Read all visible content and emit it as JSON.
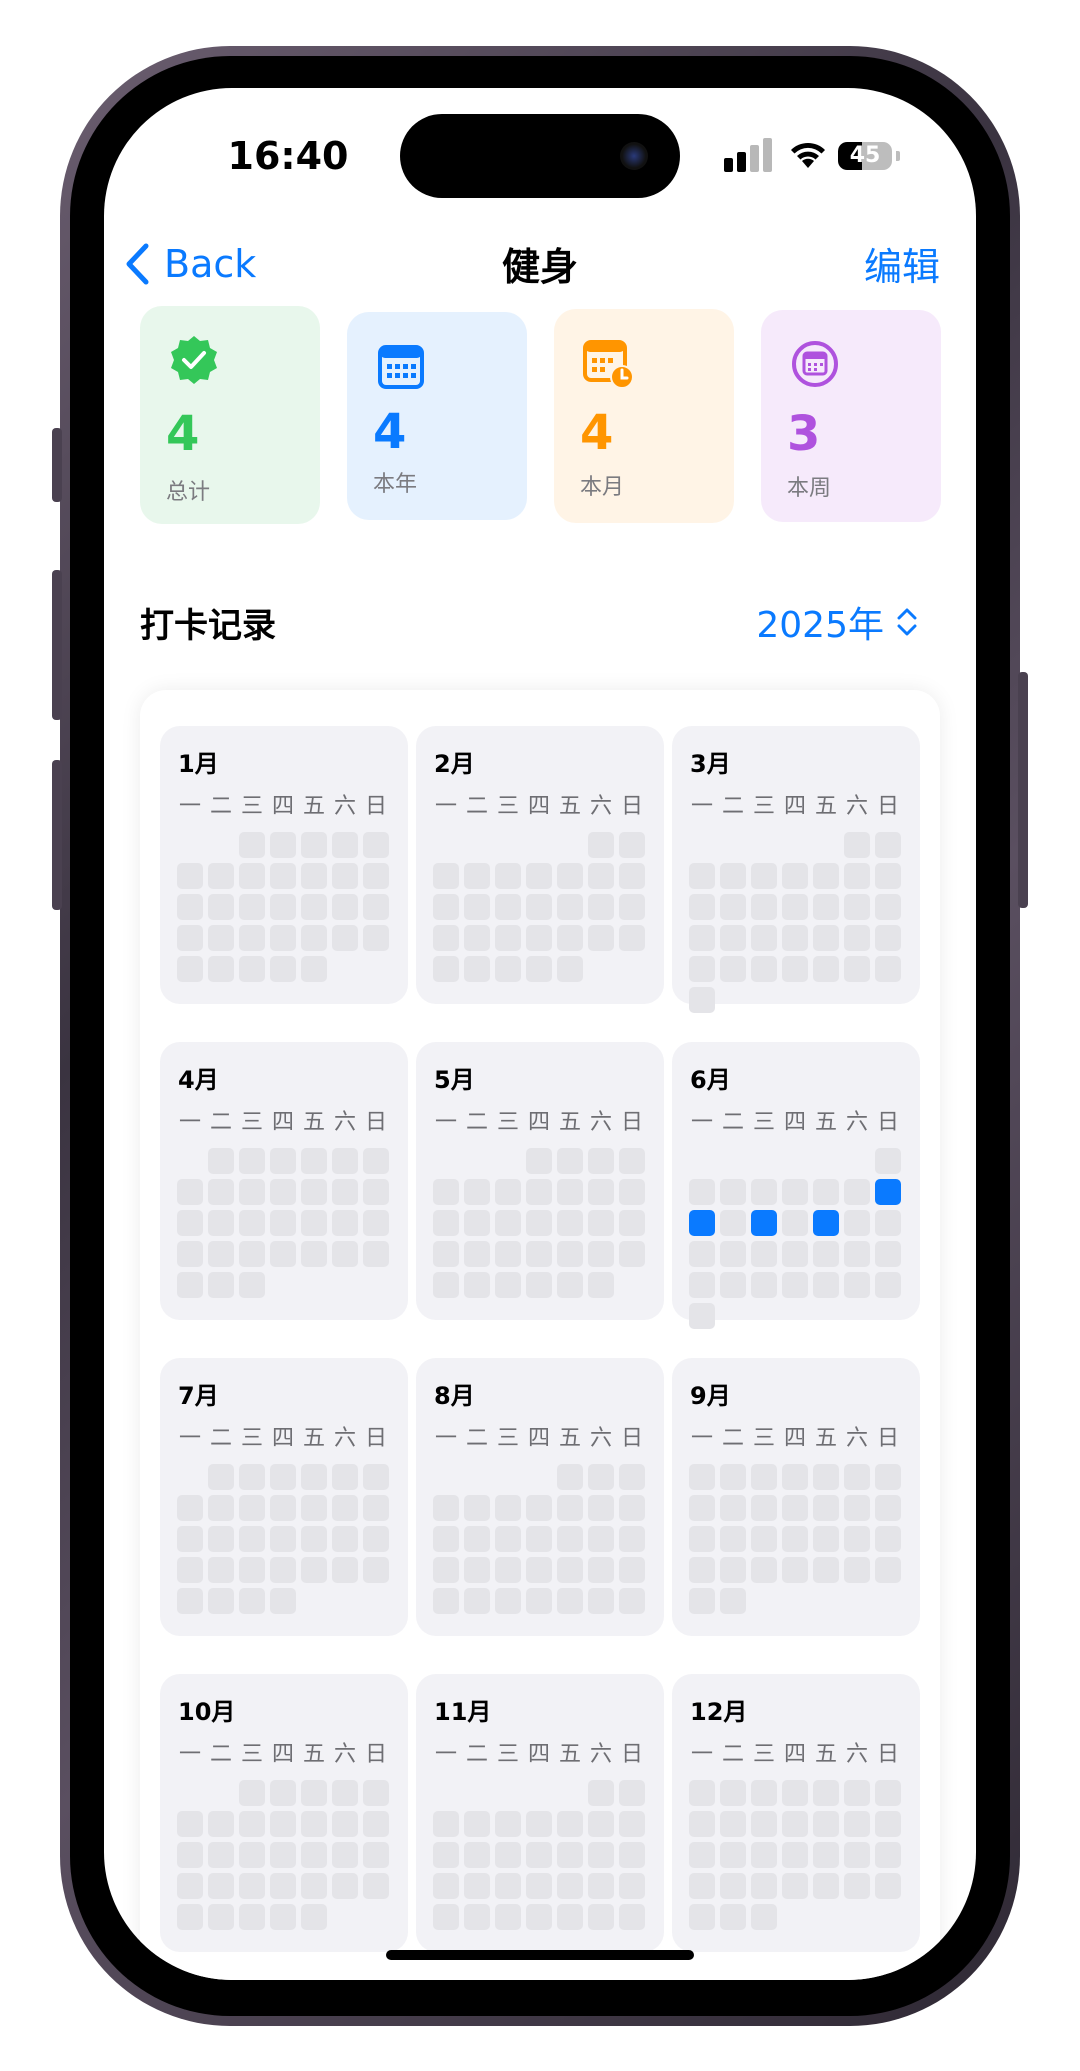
{
  "status_bar": {
    "time": "16:40",
    "battery_level": "45",
    "battery_fraction": 0.45
  },
  "nav": {
    "back_label": "Back",
    "title": "健身",
    "edit_label": "编辑"
  },
  "stats": [
    {
      "value": "4",
      "label": "总计",
      "color": "#34c759",
      "bg": "#e8f7ec",
      "icon": "check-badge-icon"
    },
    {
      "value": "4",
      "label": "本年",
      "color": "#0a7aff",
      "bg": "#e5f1fe",
      "icon": "calendar-icon"
    },
    {
      "value": "4",
      "label": "本月",
      "color": "#ff9500",
      "bg": "#fff4e6",
      "icon": "calendar-clock-icon"
    },
    {
      "value": "3",
      "label": "本周",
      "color": "#af52de",
      "bg": "#f6eafb",
      "icon": "calendar-circle-icon"
    }
  ],
  "section": {
    "title": "打卡记录",
    "year_label": "2025年"
  },
  "weekdays": [
    "一",
    "二",
    "三",
    "四",
    "五",
    "六",
    "日"
  ],
  "months": [
    {
      "label": "1月",
      "start": 2,
      "days": 31,
      "done": []
    },
    {
      "label": "2月",
      "start": 5,
      "days": 28,
      "done": []
    },
    {
      "label": "3月",
      "start": 5,
      "days": 31,
      "done": []
    },
    {
      "label": "4月",
      "start": 1,
      "days": 30,
      "done": []
    },
    {
      "label": "5月",
      "start": 3,
      "days": 31,
      "done": []
    },
    {
      "label": "6月",
      "start": 6,
      "days": 30,
      "done": [
        8,
        9,
        11,
        13
      ]
    },
    {
      "label": "7月",
      "start": 1,
      "days": 31,
      "done": []
    },
    {
      "label": "8月",
      "start": 4,
      "days": 31,
      "done": []
    },
    {
      "label": "9月",
      "start": 0,
      "days": 30,
      "done": []
    },
    {
      "label": "10月",
      "start": 2,
      "days": 31,
      "done": []
    },
    {
      "label": "11月",
      "start": 5,
      "days": 30,
      "done": []
    },
    {
      "label": "12月",
      "start": 0,
      "days": 31,
      "done": []
    }
  ]
}
